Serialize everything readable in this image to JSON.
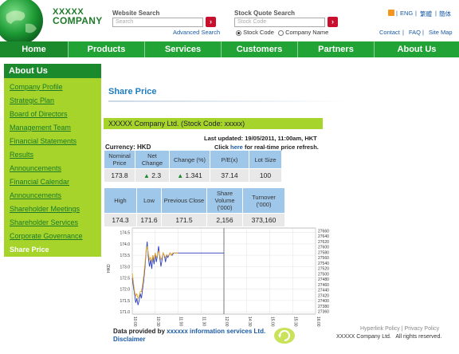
{
  "header": {
    "logo_line1": "XXXXX",
    "logo_line2": "COMPANY",
    "website_search": {
      "title": "Website Search",
      "placeholder": "Search",
      "advanced_link": "Advanced Search"
    },
    "stock_search": {
      "title": "Stock Quote Search",
      "placeholder": "Stock Code",
      "options": [
        "Stock Code",
        "Company Name"
      ],
      "selected": "Stock Code"
    },
    "languages": [
      "ENG",
      "繁體",
      "簡体"
    ],
    "utility_links": [
      "Contact",
      "FAQ",
      "Site Map"
    ],
    "go_label": "›",
    "separator": "|"
  },
  "nav": {
    "items": [
      "Home",
      "Products",
      "Services",
      "Customers",
      "Partners",
      "About Us"
    ],
    "active": "Home"
  },
  "sidebar": {
    "title": "About Us",
    "items": [
      "Company Profile",
      "Strategic Plan",
      "Board of Directors",
      "Management Team",
      "Financial Statements",
      "Results",
      "Announcements",
      "Financial Calendar",
      "Announcements",
      "Shareholder Meetings",
      "Shareholder Services",
      "Corporate Governance",
      "Share Price"
    ],
    "active": "Share Price"
  },
  "main": {
    "page_title": "Share Price",
    "stock_banner": "XXXXX Company Ltd. (Stock Code: xxxxx)",
    "last_updated": "Last updated: 19/05/2011, 11:00am, HKT",
    "refresh_pre": "Click ",
    "refresh_link": "here",
    "refresh_post": " for real-time price refresh.",
    "currency": "Currency: HKD",
    "table1": {
      "headers": [
        "Nominal Price",
        "Net Change",
        "Change (%)",
        "P/E(x)",
        "Lot Size"
      ],
      "values": [
        "173.8",
        "2.3",
        "1.341",
        "37.14",
        "100"
      ]
    },
    "table2": {
      "headers": [
        "High",
        "Low",
        "Previous Close",
        "Share Volume ('000)",
        "Turnover ('000)"
      ],
      "values": [
        "174.3",
        "171.6",
        "171.5",
        "2,156",
        "373,160"
      ]
    }
  },
  "chart_data": {
    "type": "line",
    "title": "",
    "ylabel": "HKD",
    "y_left": {
      "ticks": [
        171.0,
        171.5,
        172.0,
        172.5,
        173.0,
        173.5,
        174.0,
        174.5
      ],
      "range": [
        170.9,
        174.7
      ]
    },
    "y_right": {
      "ticks": [
        27360,
        27380,
        27400,
        27420,
        27440,
        27460,
        27480,
        27500,
        27520,
        27540,
        27560,
        27580,
        27600,
        27620,
        27640,
        27660
      ],
      "range": [
        27350,
        27670
      ]
    },
    "x_ticks": [
      "10:00",
      "10:30",
      "11:00",
      "11:30",
      "12:00",
      "14:30",
      "15:00",
      "15:30",
      "16:00"
    ],
    "series": [
      {
        "color": "#2b3fc0",
        "x": [
          0,
          0.05,
          0.1,
          0.15,
          0.2,
          0.25,
          0.3,
          0.35,
          0.4,
          0.45,
          0.5,
          0.55,
          0.6,
          0.65,
          0.7,
          0.75,
          0.8,
          0.85,
          0.9,
          0.95,
          1.0,
          1.05,
          1.1,
          1.15,
          1.2,
          1.25,
          1.3,
          1.35,
          1.4,
          1.45,
          1.5,
          1.55,
          1.6,
          1.65,
          1.7,
          1.75,
          1.8,
          1.85,
          1.9,
          1.95,
          2.0
        ],
        "values": [
          172.5,
          172.1,
          171.8,
          171.4,
          171.6,
          171.3,
          171.5,
          171.8,
          171.6,
          172.0,
          172.4,
          172.9,
          173.6,
          174.1,
          173.4,
          173.0,
          173.3,
          172.9,
          173.5,
          173.1,
          173.6,
          173.2,
          173.5,
          173.9,
          173.4,
          173.0,
          173.3,
          173.6,
          173.5,
          173.2,
          173.5,
          173.4,
          173.5,
          173.6,
          173.5,
          173.5,
          173.6,
          173.6,
          173.6,
          173.6,
          173.6
        ]
      },
      {
        "color": "#e7a325",
        "x": [
          0,
          0.05,
          0.1,
          0.15,
          0.2,
          0.25,
          0.3,
          0.35,
          0.4,
          0.45,
          0.5,
          0.55,
          0.6,
          0.65,
          0.7,
          0.75,
          0.8,
          0.85,
          0.9,
          0.95,
          1.0,
          1.05,
          1.1,
          1.15,
          1.2,
          1.25,
          1.3,
          1.35,
          1.4,
          1.45,
          1.5,
          1.55,
          1.6,
          1.65,
          1.7,
          1.75,
          1.8,
          1.85,
          1.9,
          1.95,
          2.0
        ],
        "values": [
          172.7,
          172.3,
          171.9,
          171.7,
          171.8,
          171.6,
          171.7,
          171.9,
          171.9,
          172.2,
          172.6,
          173.1,
          173.7,
          173.9,
          173.6,
          173.3,
          173.4,
          173.2,
          173.5,
          173.3,
          173.6,
          173.4,
          173.5,
          173.7,
          173.5,
          173.3,
          173.4,
          173.6,
          173.5,
          173.4,
          173.5,
          173.5,
          173.5,
          173.6,
          173.5,
          173.6,
          173.6,
          173.6,
          173.6,
          173.6,
          173.6
        ]
      }
    ],
    "x_range": [
      0,
      8
    ]
  },
  "footer": {
    "provided_pre": "Data provided by ",
    "provided_link": "xxxxxx information services Ltd.",
    "disclaimer": "Disclaimer",
    "policy_links": [
      "Hyperlink Policy",
      "Privacy Policy"
    ],
    "policy_separator": "|",
    "copyright": "XXXXX Company Ltd.   All rights reserved."
  }
}
